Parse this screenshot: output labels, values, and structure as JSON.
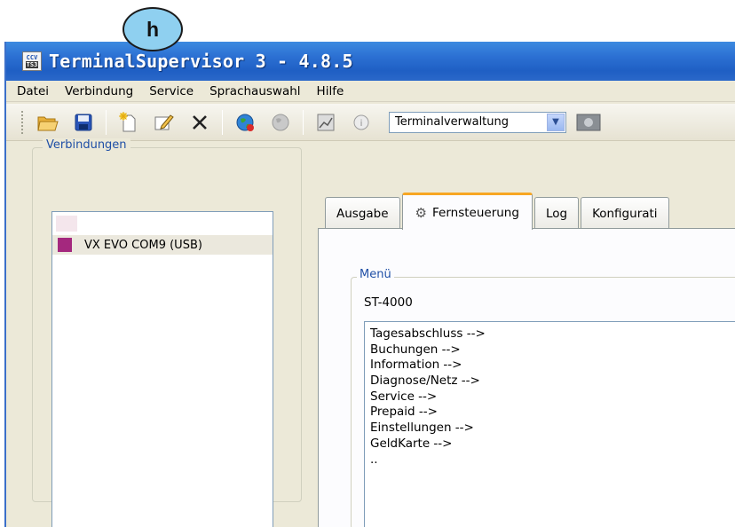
{
  "callout": {
    "label": "h"
  },
  "window": {
    "title": "TerminalSupervisor 3 - 4.8.5",
    "app_icon_top": "CCV",
    "app_icon_bottom": "TS3"
  },
  "menubar": {
    "items": [
      "Datei",
      "Verbindung",
      "Service",
      "Sprachauswahl",
      "Hilfe"
    ]
  },
  "toolbar": {
    "buttons": [
      "open-folder",
      "save",
      "new",
      "edit",
      "delete",
      "connect",
      "disconnect",
      "chart",
      "info"
    ],
    "combo_value": "Terminalverwaltung"
  },
  "connections": {
    "legend": "Verbindungen",
    "items": [
      {
        "label": "VX EVO COM9 (USB)",
        "color": "#a4287e"
      }
    ]
  },
  "tabs": [
    {
      "label": "Ausgabe",
      "active": false
    },
    {
      "label": "Fernsteuerung",
      "active": true
    },
    {
      "label": "Log",
      "active": false
    },
    {
      "label": "Konfigurati",
      "active": false
    }
  ],
  "remote": {
    "legend": "Menü",
    "terminal_id": "ST-4000",
    "entries": [
      "Tagesabschluss -->",
      "Buchungen -->",
      "Information -->",
      "Diagnose/Netz -->",
      "Service -->",
      "Prepaid -->",
      "Einstellungen -->",
      "GeldKarte -->",
      ".."
    ]
  }
}
